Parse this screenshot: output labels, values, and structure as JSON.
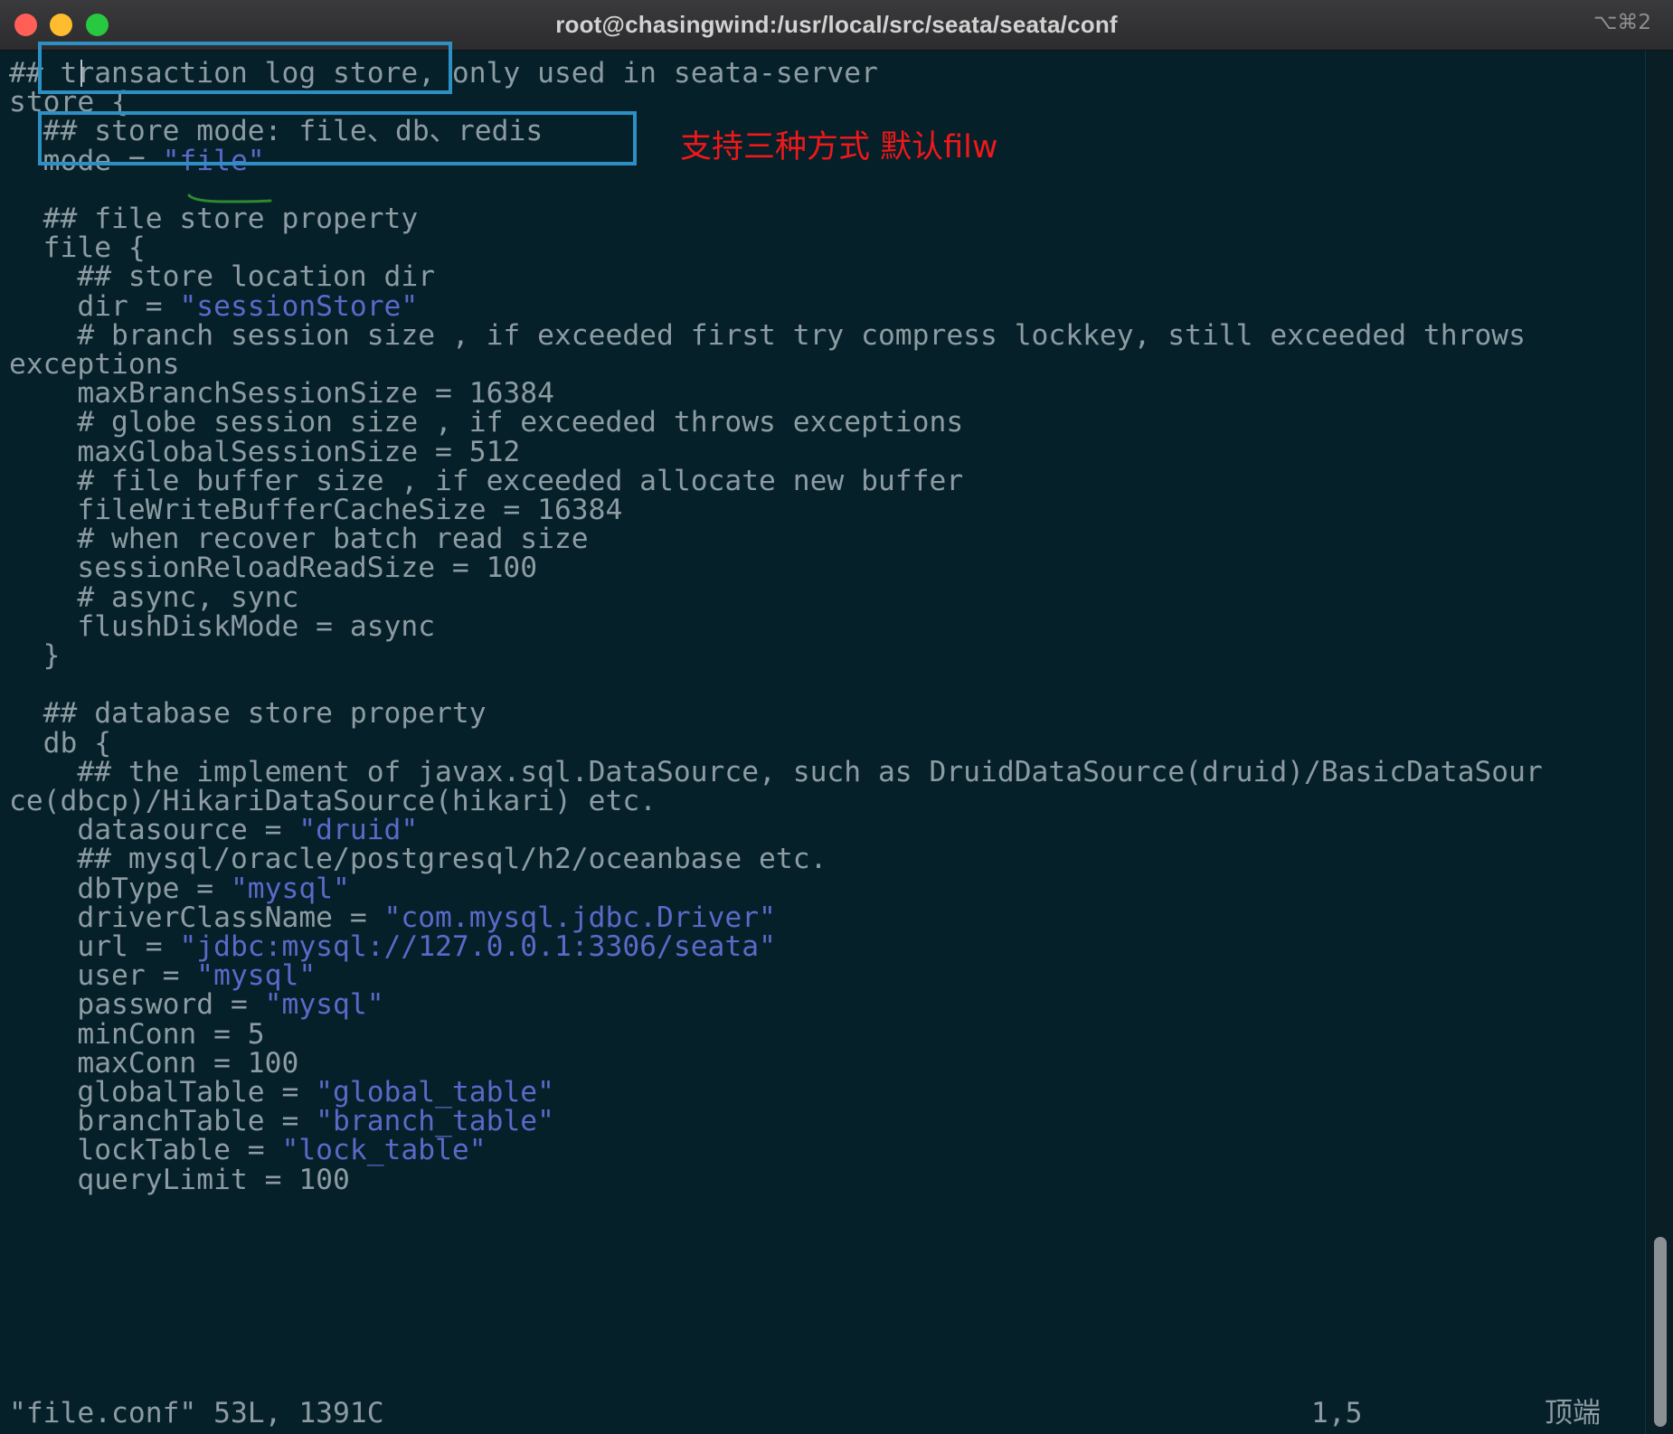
{
  "window": {
    "title": "root@chasingwind:/usr/local/src/seata/seata/conf",
    "shortcut": "⌥⌘2"
  },
  "colors": {
    "background": "#06202a",
    "text": "#8d9ca2",
    "string": "#5d68c8",
    "annotation_box": "#2e8fc4",
    "annotation_text": "#f01818",
    "underline": "#2e8a2e"
  },
  "annotation": {
    "note": "支持三种方式 默认filw"
  },
  "editor": {
    "lines": [
      {
        "pre": "## transaction log store, only used in seata-server"
      },
      {
        "pre": "store {"
      },
      {
        "pre": "  ## store mode: file、db、redis"
      },
      {
        "pre": "  mode = ",
        "str": "\"file\""
      },
      {
        "pre": ""
      },
      {
        "pre": "  ## file store property"
      },
      {
        "pre": "  file {"
      },
      {
        "pre": "    ## store location dir"
      },
      {
        "pre": "    dir = ",
        "str": "\"sessionStore\""
      },
      {
        "pre": "    # branch session size , if exceeded first try compress lockkey, still exceeded throws"
      },
      {
        "pre": "exceptions"
      },
      {
        "pre": "    maxBranchSessionSize = 16384"
      },
      {
        "pre": "    # globe session size , if exceeded throws exceptions"
      },
      {
        "pre": "    maxGlobalSessionSize = 512"
      },
      {
        "pre": "    # file buffer size , if exceeded allocate new buffer"
      },
      {
        "pre": "    fileWriteBufferCacheSize = 16384"
      },
      {
        "pre": "    # when recover batch read size"
      },
      {
        "pre": "    sessionReloadReadSize = 100"
      },
      {
        "pre": "    # async, sync"
      },
      {
        "pre": "    flushDiskMode = async"
      },
      {
        "pre": "  }"
      },
      {
        "pre": ""
      },
      {
        "pre": "  ## database store property"
      },
      {
        "pre": "  db {"
      },
      {
        "pre": "    ## the implement of javax.sql.DataSource, such as DruidDataSource(druid)/BasicDataSour"
      },
      {
        "pre": "ce(dbcp)/HikariDataSource(hikari) etc."
      },
      {
        "pre": "    datasource = ",
        "str": "\"druid\""
      },
      {
        "pre": "    ## mysql/oracle/postgresql/h2/oceanbase etc."
      },
      {
        "pre": "    dbType = ",
        "str": "\"mysql\""
      },
      {
        "pre": "    driverClassName = ",
        "str": "\"com.mysql.jdbc.Driver\""
      },
      {
        "pre": "    url = ",
        "str": "\"jdbc:mysql://127.0.0.1:3306/seata\""
      },
      {
        "pre": "    user = ",
        "str": "\"mysql\""
      },
      {
        "pre": "    password = ",
        "str": "\"mysql\""
      },
      {
        "pre": "    minConn = 5"
      },
      {
        "pre": "    maxConn = 100"
      },
      {
        "pre": "    globalTable = ",
        "str": "\"global_table\""
      },
      {
        "pre": "    branchTable = ",
        "str": "\"branch_table\""
      },
      {
        "pre": "    lockTable = ",
        "str": "\"lock_table\""
      },
      {
        "pre": "    queryLimit = 100"
      }
    ]
  },
  "statusline": {
    "file_info": "\"file.conf\" 53L, 1391C",
    "position": "1,5",
    "scroll": "顶端"
  }
}
